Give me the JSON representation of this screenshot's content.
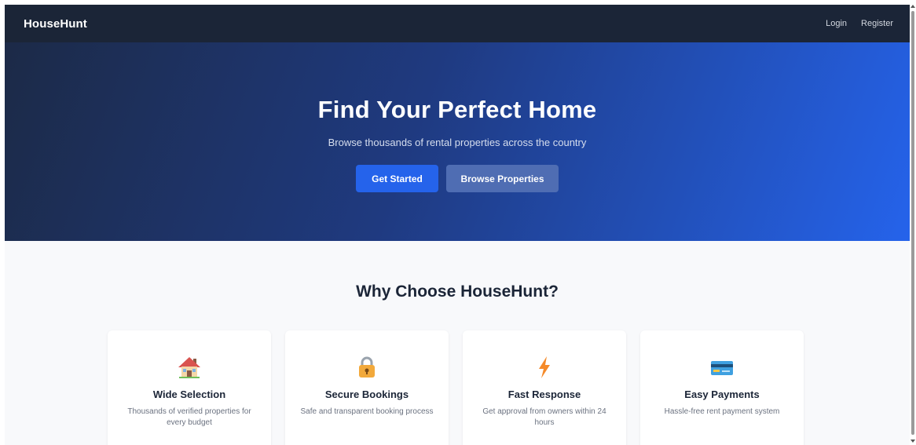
{
  "navbar": {
    "brand": "HouseHunt",
    "links": [
      "Login",
      "Register"
    ]
  },
  "hero": {
    "title": "Find Your Perfect Home",
    "subtitle": "Browse thousands of rental properties across the country",
    "primary_button": "Get Started",
    "secondary_button": "Browse Properties"
  },
  "features": {
    "title": "Why Choose HouseHunt?",
    "cards": [
      {
        "icon": "house-icon",
        "title": "Wide Selection",
        "description": "Thousands of verified properties for every budget"
      },
      {
        "icon": "lock-icon",
        "title": "Secure Bookings",
        "description": "Safe and transparent booking process"
      },
      {
        "icon": "lightning-icon",
        "title": "Fast Response",
        "description": "Get approval from owners within 24 hours"
      },
      {
        "icon": "credit-card-icon",
        "title": "Easy Payments",
        "description": "Hassle-free rent payment system"
      }
    ]
  },
  "colors": {
    "navbar": "#1b2537",
    "accent": "#2563eb",
    "secondary_button": "#4f6db3"
  }
}
